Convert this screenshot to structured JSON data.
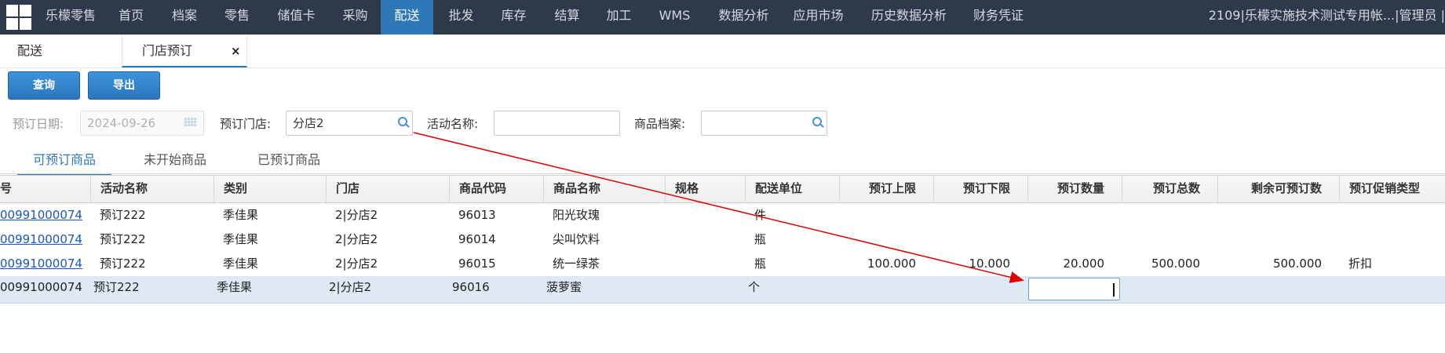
{
  "nav": {
    "items": [
      "乐檬零售",
      "首页",
      "档案",
      "零售",
      "储值卡",
      "采购",
      "配送",
      "批发",
      "库存",
      "结算",
      "加工",
      "WMS",
      "数据分析",
      "应用市场",
      "历史数据分析",
      "财务凭证"
    ],
    "active": "配送",
    "account": "2109|乐檬实施技术测试专用帐...|管理员 |"
  },
  "tabs": {
    "first": "配送",
    "second": "门店预订",
    "close_glyph": "×"
  },
  "toolbar": {
    "query_label": "查询",
    "export_label": "导出"
  },
  "filters": {
    "date_label": "预订日期:",
    "date_value": "2024-09-26",
    "store_label": "预订门店:",
    "store_value": "分店2",
    "activity_label": "活动名称:",
    "activity_value": "",
    "product_label": "商品档案:",
    "product_value": ""
  },
  "subtabs": [
    "可预订商品",
    "未开始商品",
    "已预订商品"
  ],
  "table": {
    "columns": [
      "号",
      "活动名称",
      "类别",
      "门店",
      "商品代码",
      "商品名称",
      "规格",
      "配送单位",
      "预订上限",
      "预订下限",
      "预订数量",
      "预订总数",
      "剩余可预订数",
      "预订促销类型"
    ],
    "rows": [
      [
        "00991000074",
        "预订222",
        "季佳果",
        "2|分店2",
        "96013",
        "阳光玫瑰",
        "",
        "件",
        "",
        "",
        "",
        "",
        "",
        ""
      ],
      [
        "00991000074",
        "预订222",
        "季佳果",
        "2|分店2",
        "96014",
        "尖叫饮料",
        "",
        "瓶",
        "",
        "",
        "",
        "",
        "",
        ""
      ],
      [
        "00991000074",
        "预订222",
        "季佳果",
        "2|分店2",
        "96015",
        "统一绿茶",
        "",
        "瓶",
        "100.000",
        "10.000",
        "20.000",
        "500.000",
        "500.000",
        "折扣"
      ],
      [
        "00991000074",
        "预订222",
        "季佳果",
        "2|分店2",
        "96016",
        "菠萝蜜",
        "",
        "个",
        "",
        "",
        "",
        "",
        "",
        ""
      ]
    ],
    "editing_cell_value": ""
  },
  "colors": {
    "nav_bg": "#2e3a4b",
    "nav_active": "#2f78b7",
    "button": "#2f78b7",
    "link": "#1a55c4",
    "selected_row": "#dfe9f3",
    "annotation_arrow": "#e00000"
  }
}
